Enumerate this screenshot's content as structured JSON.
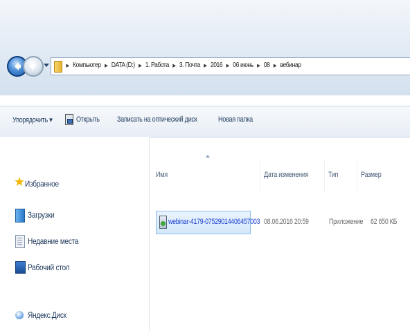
{
  "address": {
    "crumbs": [
      "Компьютер",
      "DATA (D:)",
      "1. Работа",
      "3. Почта",
      "2016",
      "06 июнь",
      "08",
      "вебинар"
    ]
  },
  "toolbar": {
    "organize_label": "Упорядочить ▾",
    "open_label": "Открыть",
    "burn_label": "Записать на оптический диск",
    "new_folder_label": "Новая папка"
  },
  "nav": {
    "favorites": "Избранное",
    "downloads": "Загрузки",
    "recent": "Недавние места",
    "desktop": "Рабочий стол",
    "yandex_disk": "Яндекс.Диск"
  },
  "columns": {
    "name": "Имя",
    "date": "Дата изменения",
    "type": "Тип",
    "size": "Размер"
  },
  "files": [
    {
      "name": "webinar-4179-07529014406457003",
      "date": "08.06.2016 20:59",
      "type": "Приложение",
      "size": "62 650 КБ"
    }
  ],
  "colors": {
    "accent": "#1e395b",
    "selection": "#d3e8fb",
    "link": "#1a3fd0"
  }
}
